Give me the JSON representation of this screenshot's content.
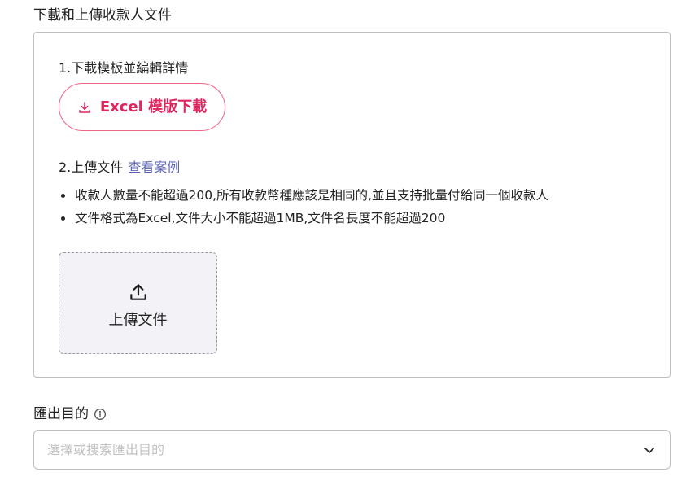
{
  "upload_section": {
    "title": "下載和上傳收款人文件",
    "step1_label": "1.下載模板並編輯詳情",
    "download_button_label": "Excel 模版下載",
    "step2_label": "2.上傳文件",
    "example_link": "查看案例",
    "rules": [
      "收款人數量不能超過200,所有收款幣種應該是相同的,並且支持批量付給同一個收款人",
      "文件格式為Excel,文件大小不能超過1MB,文件名長度不能超過200"
    ],
    "dropzone_label": "上傳文件"
  },
  "export_purpose": {
    "label": "匯出目的",
    "placeholder": "選擇或搜索匯出目的"
  },
  "icons": {
    "download": "download-icon",
    "upload": "upload-icon",
    "info": "info-icon",
    "dropdown": "chevron-down-icon"
  },
  "colors": {
    "accent": "#e0245e",
    "link": "#5b63b7",
    "dropzone_bg": "#f3f2f7",
    "border": "#bfbfbf"
  }
}
